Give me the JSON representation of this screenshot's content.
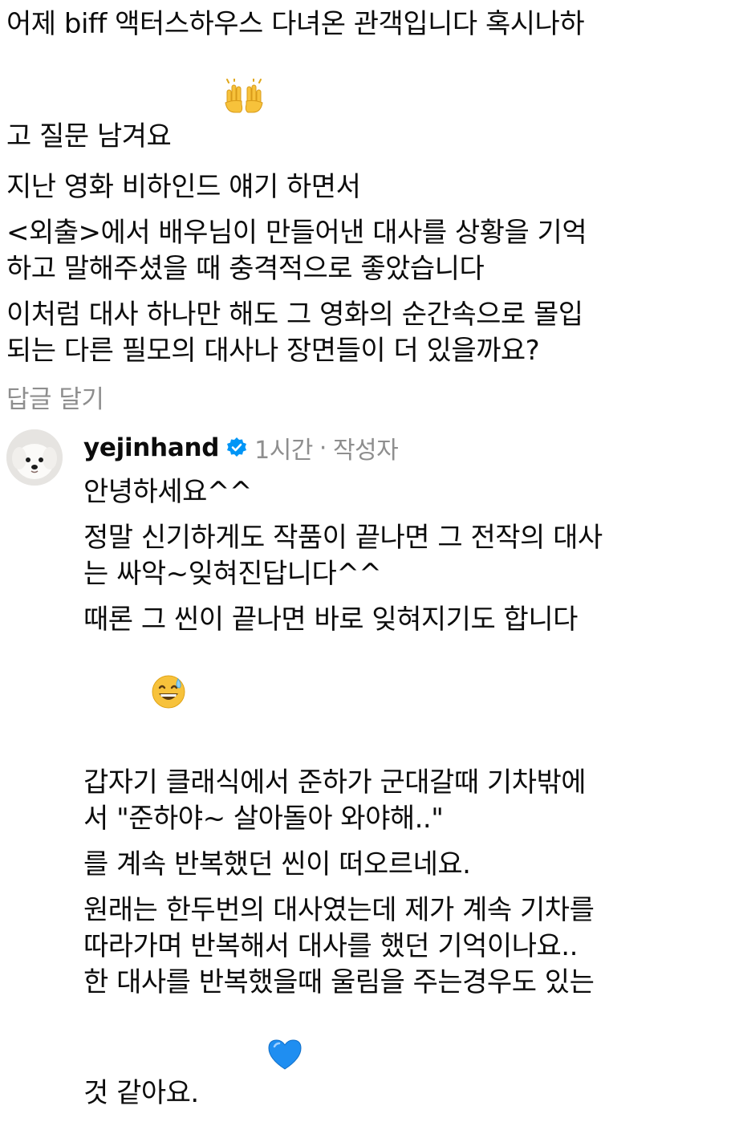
{
  "top_comment": {
    "paragraphs": [
      "어제 biff 액터스하우스 다녀온 관객입니다 혹시나하\n고 질문 남겨요",
      "지난 영화 비하인드 얘기 하면서",
      "<외출>에서 배우님이 만들어낸 대사를 상황을 기억\n하고 말해주셨을 때 충격적으로 좋았습니다",
      "이처럼 대사 하나만 해도 그 영화의 순간속으로 몰입\n되는 다른 필모의 대사나 장면들이 더 있을까요?"
    ],
    "emoji_after_first": "raising-hands-emoji",
    "reply_link": "답글 달기"
  },
  "reply": {
    "username": "yejinhand",
    "verified": true,
    "time": "1시간",
    "separator": "·",
    "author_tag": "작성자",
    "paragraphs": [
      "안녕하세요^^",
      "정말 신기하게도 작품이 끝나면 그 전작의 대사\n는 싸악~잊혀진답니다^^",
      "때론 그 씬이 끝나면 바로 잊혀지기도 합니다",
      "갑자기 클래식에서 준하가 군대갈때 기차밖에\n서 \"준하야~ 살아돌아 와야해..\"",
      "를 계속 반복했던 씬이 떠오르네요.",
      "원래는 한두번의 대사였는데 제가 계속 기차를\n따라가며 반복해서 대사를 했던 기억이나요..\n한 대사를 반복했을때 울림을 주는경우도 있는\n것 같아요."
    ],
    "emoji_after_third": "grinning-sweat-emoji",
    "emoji_after_last": "blue-heart-emoji"
  },
  "colors": {
    "text": "#0c0c0c",
    "muted": "#8e8e8e",
    "verified_blue": "#0095f6"
  }
}
